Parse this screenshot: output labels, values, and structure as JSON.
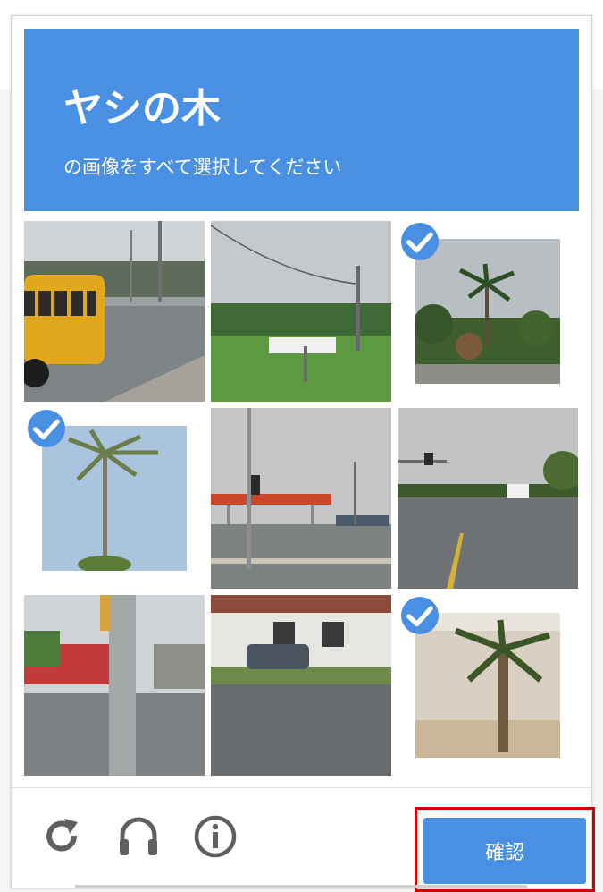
{
  "challenge": {
    "title": "ヤシの木",
    "subtitle": "の画像をすべて選択してください"
  },
  "grid": {
    "tiles": [
      {
        "id": 1,
        "scene": "school-bus",
        "selected": false
      },
      {
        "id": 2,
        "scene": "field-power-lines",
        "selected": false
      },
      {
        "id": 3,
        "scene": "palm-trees-bushes",
        "selected": true
      },
      {
        "id": 4,
        "scene": "tall-palm-sky",
        "selected": true
      },
      {
        "id": 5,
        "scene": "gas-station",
        "selected": false
      },
      {
        "id": 6,
        "scene": "road-traffic-lights",
        "selected": false
      },
      {
        "id": 7,
        "scene": "street-pole-shops",
        "selected": false
      },
      {
        "id": 8,
        "scene": "building-parked-car",
        "selected": false
      },
      {
        "id": 9,
        "scene": "palm-near-wall",
        "selected": true
      }
    ]
  },
  "footer": {
    "reload_icon": "reload-icon",
    "audio_icon": "headphones-icon",
    "info_icon": "info-icon",
    "verify_label": "確認",
    "highlight_color": "#d10000"
  },
  "colors": {
    "accent": "#4a90e2"
  }
}
